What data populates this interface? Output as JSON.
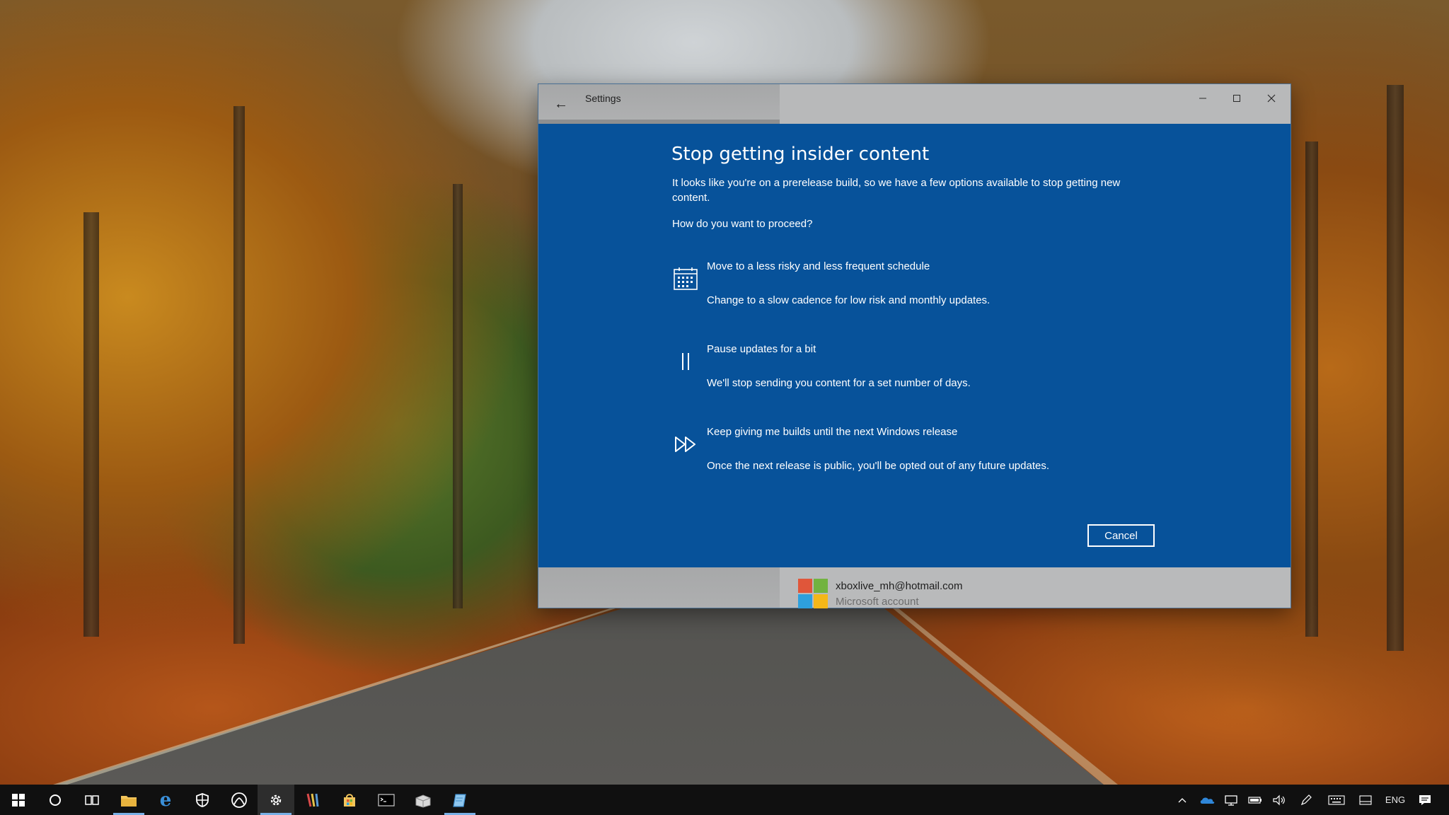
{
  "window": {
    "title": "Settings",
    "back_glyph": "←",
    "min_glyph": "–",
    "close_glyph": "✕"
  },
  "dialog": {
    "heading": "Stop getting insider content",
    "intro": "It looks like you're on a prerelease build, so we have a few options available to stop getting new content.",
    "question": "How do you want to proceed?",
    "options": [
      {
        "icon": "calendar-icon",
        "title": "Move to a less risky and less frequent schedule",
        "description": "Change to a slow cadence for low risk and monthly updates."
      },
      {
        "icon": "pause-icon",
        "title": "Pause updates for a bit",
        "description": "We'll stop sending you content for a set number of days."
      },
      {
        "icon": "fast-forward-icon",
        "title": "Keep giving me builds until the next Windows release",
        "description": "Once the next release is public, you'll be opted out of any future updates."
      }
    ],
    "cancel_label": "Cancel"
  },
  "account": {
    "email": "xboxlive_mh@hotmail.com",
    "type": "Microsoft account"
  },
  "taskbar": {
    "apps": [
      "start",
      "cortana",
      "task-view",
      "file-explorer",
      "edge",
      "windows-defender",
      "xbox",
      "settings",
      "winrar",
      "store",
      "command-prompt",
      "app-installer",
      "notepad"
    ],
    "tray_language": "ENG"
  },
  "colors": {
    "dialog_background": "#07529a",
    "titlebar": "#b8b9ba",
    "taskbar": "#101010",
    "accent": "#78b0e6"
  }
}
